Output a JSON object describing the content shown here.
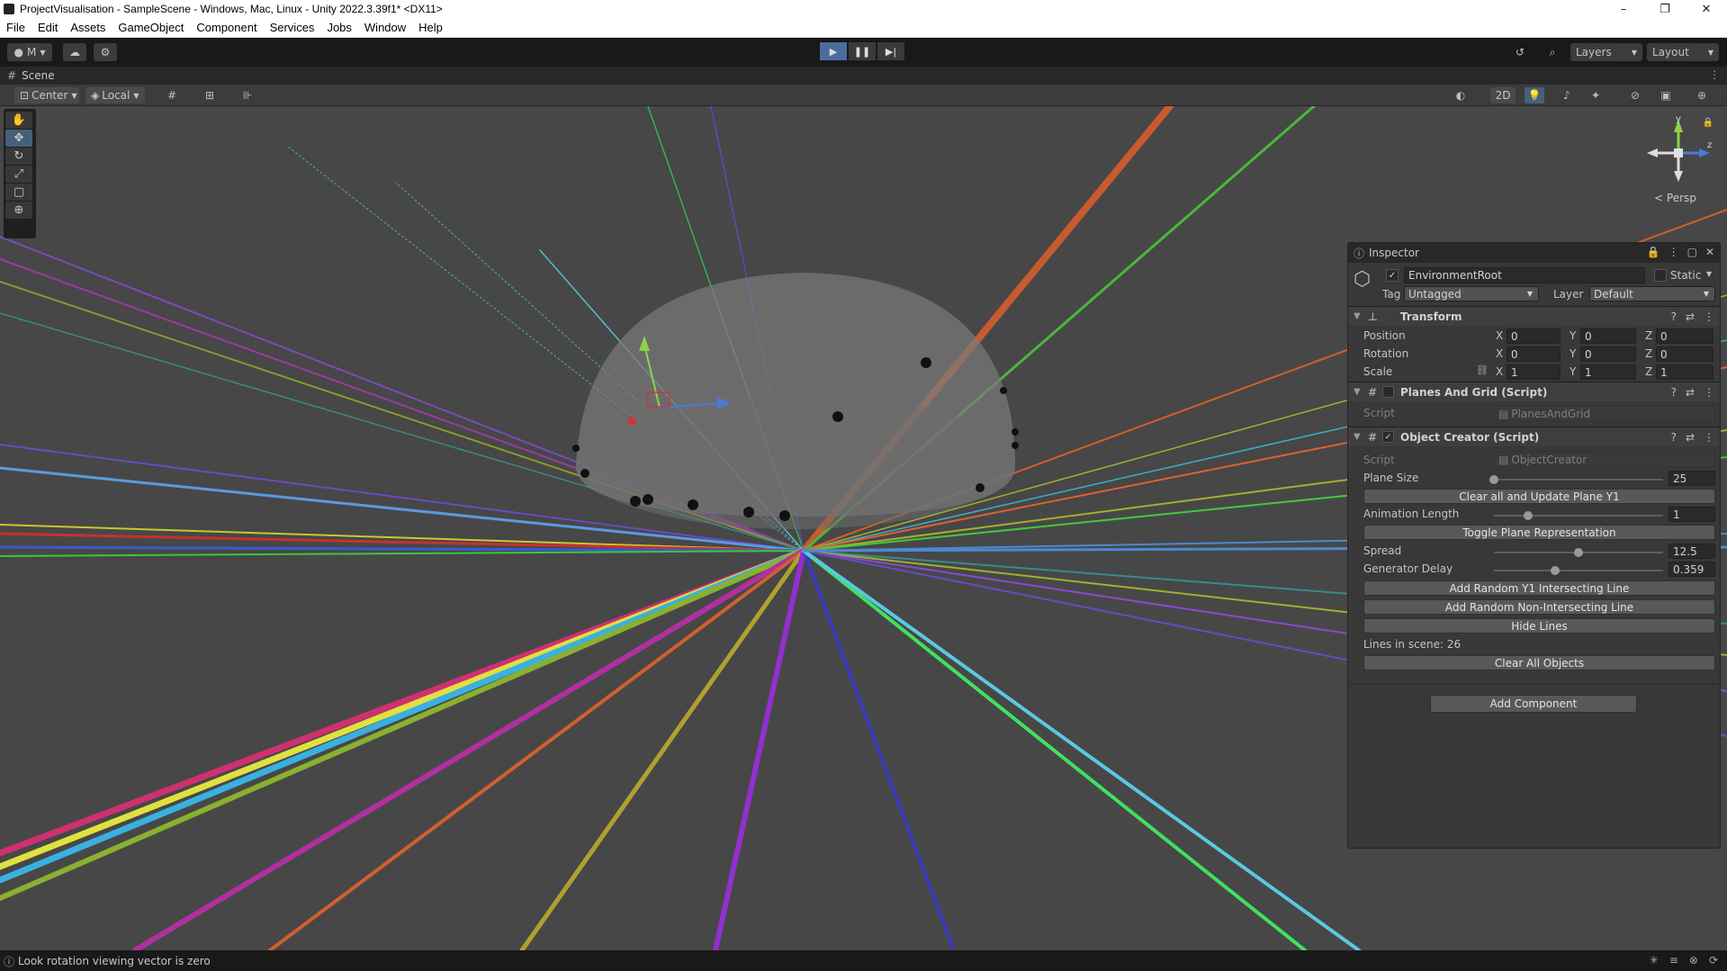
{
  "window": {
    "title": "ProjectVisualisation - SampleScene - Windows, Mac, Linux - Unity 2022.3.39f1* <DX11>",
    "minimize": "–",
    "maximize": "❐",
    "close": "✕"
  },
  "menu": [
    "File",
    "Edit",
    "Assets",
    "GameObject",
    "Component",
    "Services",
    "Jobs",
    "Window",
    "Help"
  ],
  "toolbar": {
    "account": "M",
    "layers": "Layers",
    "layout": "Layout"
  },
  "scene_tab": {
    "label": "Scene"
  },
  "scene_toolbar": {
    "pivot": "Center",
    "space": "Local",
    "mode_2d": "2D"
  },
  "view": {
    "projection": "Persp"
  },
  "inspector": {
    "title": "Inspector",
    "object_name": "EnvironmentRoot",
    "static_label": "Static",
    "tag_label": "Tag",
    "tag_value": "Untagged",
    "layer_label": "Layer",
    "layer_value": "Default",
    "transform": {
      "title": "Transform",
      "position_label": "Position",
      "rotation_label": "Rotation",
      "scale_label": "Scale",
      "position": {
        "x": "0",
        "y": "0",
        "z": "0"
      },
      "rotation": {
        "x": "0",
        "y": "0",
        "z": "0"
      },
      "scale": {
        "x": "1",
        "y": "1",
        "z": "1"
      }
    },
    "planes_and_grid": {
      "title": "Planes And Grid (Script)",
      "script_label": "Script",
      "script_value": "PlanesAndGrid"
    },
    "object_creator": {
      "title": "Object Creator (Script)",
      "script_label": "Script",
      "script_value": "ObjectCreator",
      "plane_size_label": "Plane Size",
      "plane_size_value": "25",
      "plane_size_fraction": 0.0,
      "clear_update_button": "Clear all and Update Plane Y1",
      "animation_length_label": "Animation Length",
      "animation_length_value": "1",
      "animation_length_fraction": 0.2,
      "toggle_plane_button": "Toggle Plane Representation",
      "spread_label": "Spread",
      "spread_value": "12.5",
      "spread_fraction": 0.5,
      "generator_delay_label": "Generator Delay",
      "generator_delay_value": "0.359",
      "generator_delay_fraction": 0.36,
      "add_intersecting_button": "Add Random Y1 Intersecting Line",
      "add_nonintersecting_button": "Add Random Non-Intersecting Line",
      "hide_lines_button": "Hide Lines",
      "lines_in_scene": "Lines in scene: 26",
      "clear_all_button": "Clear All Objects"
    },
    "add_component_button": "Add Component"
  },
  "status": {
    "message": "Look rotation viewing vector is zero"
  }
}
